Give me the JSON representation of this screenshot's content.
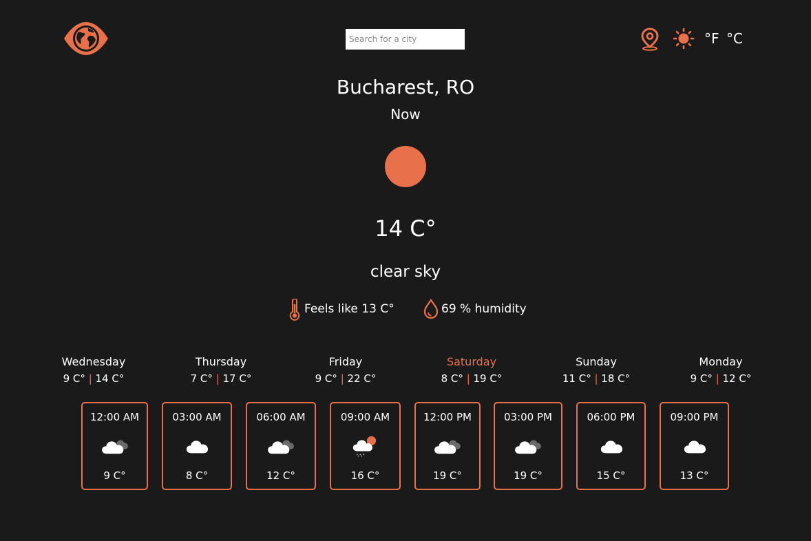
{
  "accent": "#e8704a",
  "header": {
    "logo_icon": "eye-globe-icon",
    "search_placeholder": "Search for a city",
    "location_icon": "map-pin-icon",
    "theme_icon": "sun-icon",
    "unit_f": "°F",
    "unit_c": "°C"
  },
  "current": {
    "city": "Bucharest, RO",
    "label": "Now",
    "icon": "sun-icon",
    "temp": "14 C°",
    "description": "clear sky",
    "feels_like": "Feels like 13 C°",
    "humidity": "69 % humidity"
  },
  "days": [
    {
      "name": "Wednesday",
      "min": "9 C°",
      "max": "14 C°",
      "selected": false
    },
    {
      "name": "Thursday",
      "min": "7 C°",
      "max": "17 C°",
      "selected": false
    },
    {
      "name": "Friday",
      "min": "9 C°",
      "max": "22 C°",
      "selected": false
    },
    {
      "name": "Saturday",
      "min": "8 C°",
      "max": "19 C°",
      "selected": true
    },
    {
      "name": "Sunday",
      "min": "11 C°",
      "max": "18 C°",
      "selected": false
    },
    {
      "name": "Monday",
      "min": "9 C°",
      "max": "12 C°",
      "selected": false
    }
  ],
  "hours": [
    {
      "time": "12:00 AM",
      "icon": "broken-clouds-icon",
      "temp": "9 C°"
    },
    {
      "time": "03:00 AM",
      "icon": "cloud-icon",
      "temp": "8 C°"
    },
    {
      "time": "06:00 AM",
      "icon": "broken-clouds-icon",
      "temp": "12 C°"
    },
    {
      "time": "09:00 AM",
      "icon": "light-rain-sun-icon",
      "temp": "16 C°"
    },
    {
      "time": "12:00 PM",
      "icon": "broken-clouds-icon",
      "temp": "19 C°"
    },
    {
      "time": "03:00 PM",
      "icon": "broken-clouds-icon",
      "temp": "19 C°"
    },
    {
      "time": "06:00 PM",
      "icon": "cloud-icon",
      "temp": "15 C°"
    },
    {
      "time": "09:00 PM",
      "icon": "cloud-icon",
      "temp": "13 C°"
    }
  ]
}
